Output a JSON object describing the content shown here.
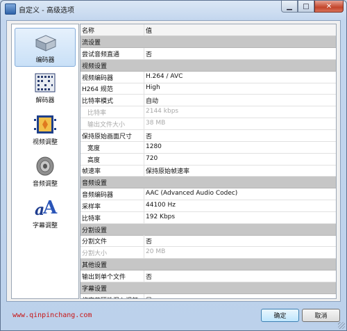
{
  "window": {
    "title": "自定义 - 高级选项"
  },
  "sidebar": {
    "items": [
      {
        "label": "编码器",
        "icon": "encoder-icon",
        "active": true
      },
      {
        "label": "解码器",
        "icon": "decoder-icon",
        "active": false
      },
      {
        "label": "视频调整",
        "icon": "video-adjust-icon",
        "active": false
      },
      {
        "label": "音频调整",
        "icon": "audio-adjust-icon",
        "active": false
      },
      {
        "label": "字幕调整",
        "icon": "subtitle-adjust-icon",
        "active": false
      }
    ]
  },
  "grid": {
    "header": {
      "name": "名称",
      "value": "值"
    },
    "rows": [
      {
        "type": "section",
        "name": "流设置"
      },
      {
        "name": "尝试音频直通",
        "value": "否"
      },
      {
        "type": "section",
        "name": "视频设置"
      },
      {
        "name": "视频编码器",
        "value": "H.264 / AVC"
      },
      {
        "name": "H264 规范",
        "value": "High"
      },
      {
        "name": "比特率模式",
        "value": "自动"
      },
      {
        "name": "比特率",
        "value": "2144 kbps",
        "sub": true,
        "disabled": true
      },
      {
        "name": "输出文件大小",
        "value": "38 MB",
        "sub": true,
        "disabled": true
      },
      {
        "name": "保持原始画面尺寸",
        "value": "否"
      },
      {
        "name": "宽度",
        "value": "1280",
        "sub": true
      },
      {
        "name": "高度",
        "value": "720",
        "sub": true
      },
      {
        "name": "帧速率",
        "value": "保持原始帧速率"
      },
      {
        "type": "section",
        "name": "音频设置"
      },
      {
        "name": "音频编码器",
        "value": "AAC (Advanced Audio Codec)"
      },
      {
        "name": "采样率",
        "value": "44100 Hz"
      },
      {
        "name": "比特率",
        "value": "192 Kbps"
      },
      {
        "type": "section",
        "name": "分割设置"
      },
      {
        "name": "分割文件",
        "value": "否"
      },
      {
        "name": "分割大小",
        "value": "20 MB",
        "disabled": true
      },
      {
        "type": "section",
        "name": "其他设置"
      },
      {
        "name": "输出到单个文件",
        "value": "否"
      },
      {
        "type": "section",
        "name": "字幕设置"
      },
      {
        "name": "将字幕硬性混入视频...",
        "value": "是"
      }
    ]
  },
  "footer": {
    "link": "www.qinpinchang.com",
    "ok_label": "确定",
    "cancel_label": "取消"
  }
}
